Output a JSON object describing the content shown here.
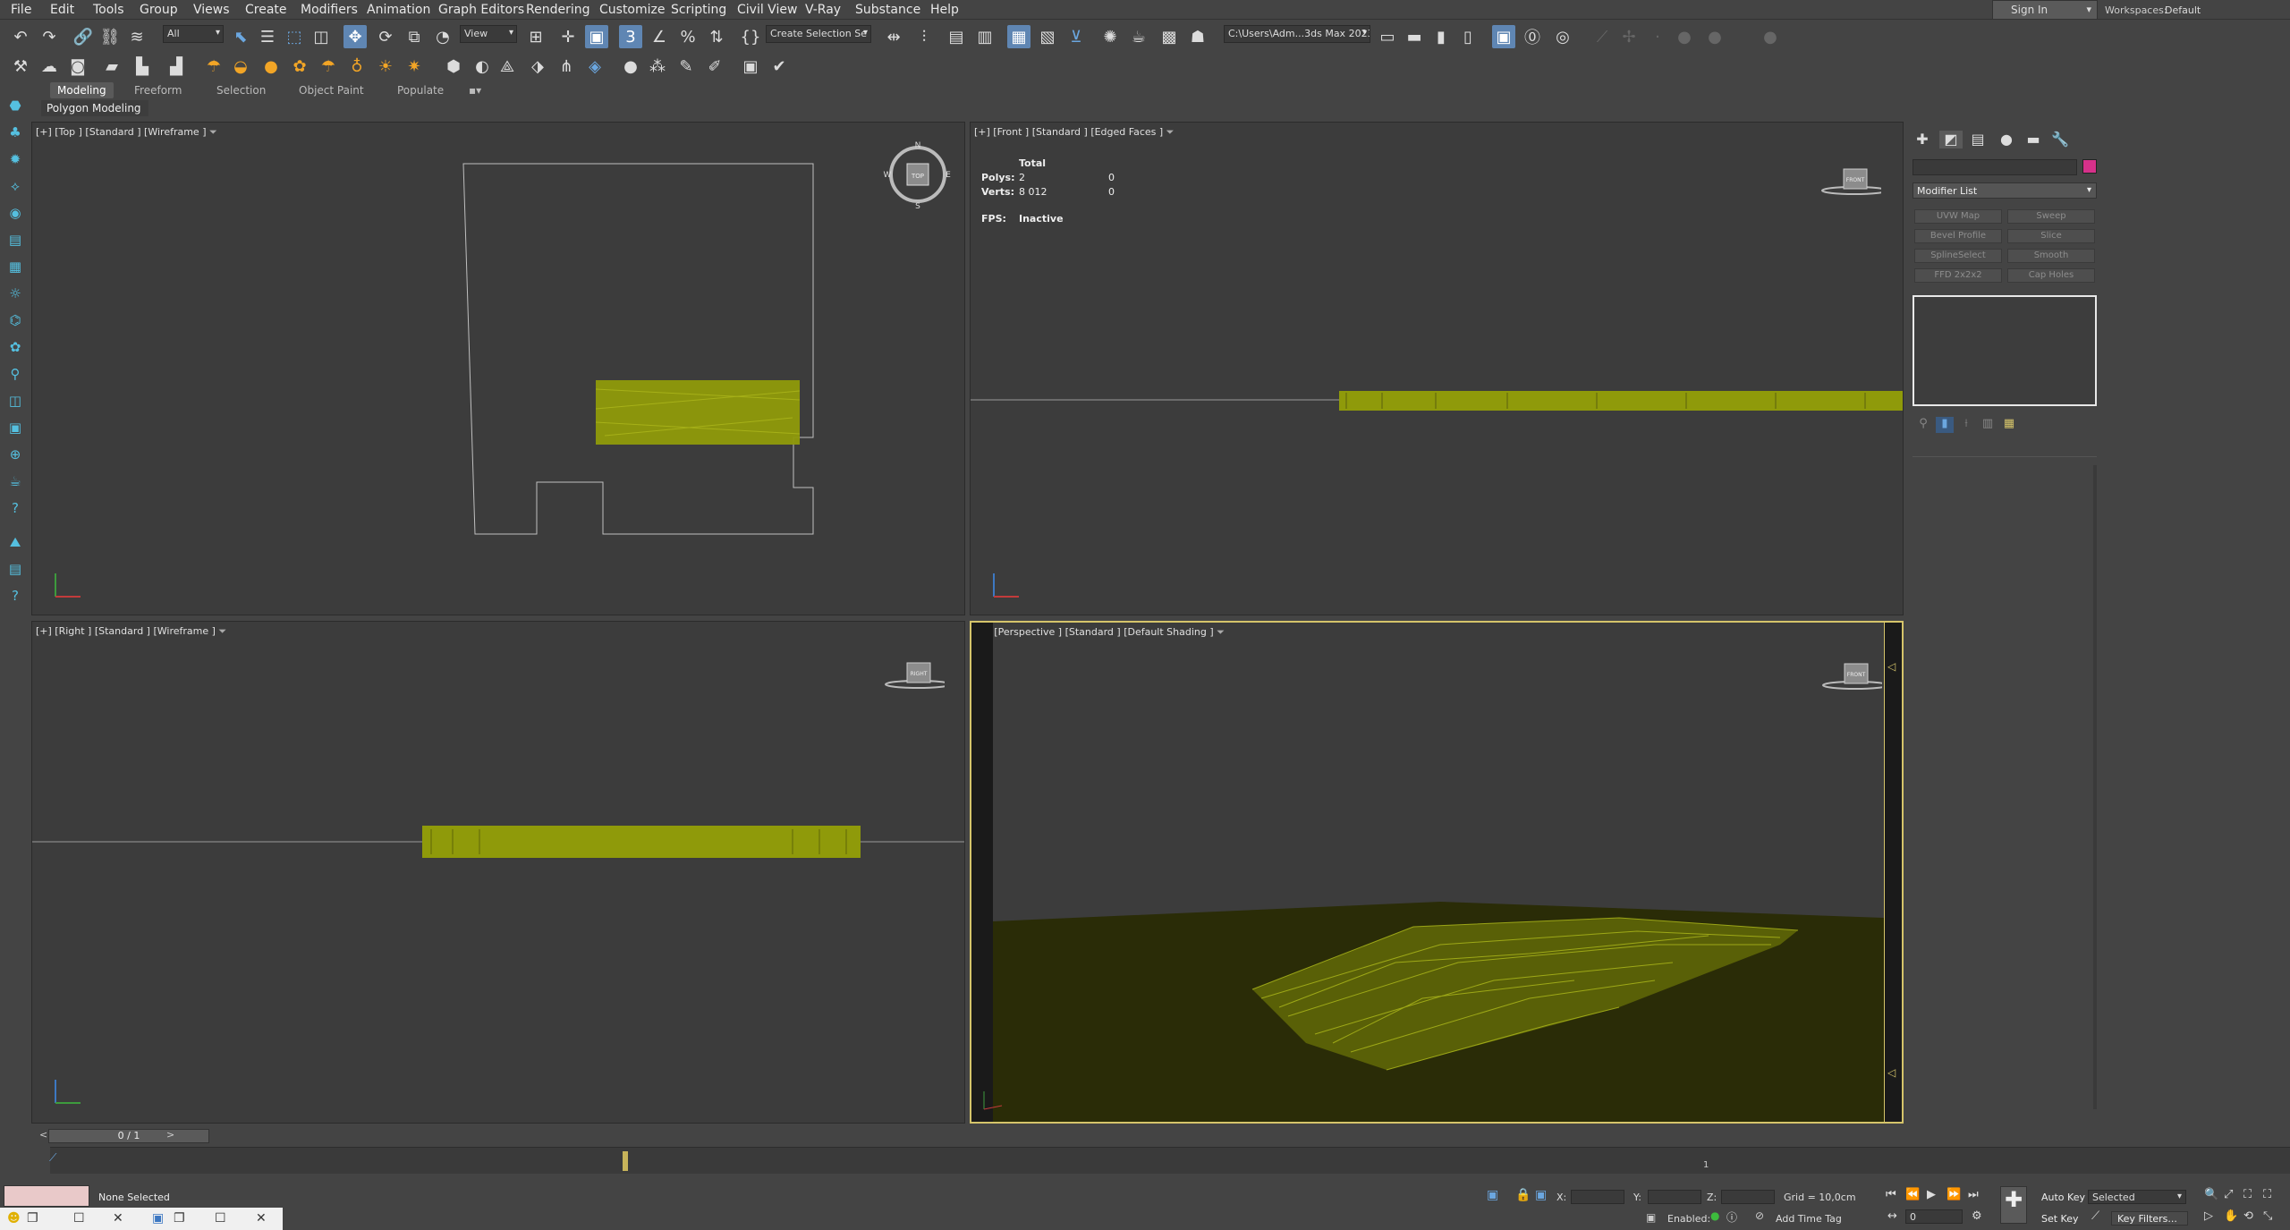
{
  "menu": {
    "items": [
      "File",
      "Edit",
      "Tools",
      "Group",
      "Views",
      "Create",
      "Modifiers",
      "Animation",
      "Graph Editors",
      "Rendering",
      "Customize",
      "Scripting",
      "Civil View",
      "V-Ray",
      "Substance",
      "Help"
    ],
    "sign_in": "Sign In",
    "workspaces_label": "Workspaces:",
    "workspaces_value": "Default"
  },
  "toolbar": {
    "selection_filter": "All",
    "ref_coord": "View",
    "named_selection": "Create Selection Se",
    "project_path": "C:\\Users\\Adm...3ds Max 2023"
  },
  "ribbon": {
    "tabs": [
      "Modeling",
      "Freeform",
      "Selection",
      "Object Paint",
      "Populate"
    ],
    "active_tab": "Modeling",
    "panel_label": "Polygon Modeling"
  },
  "viewports": {
    "top": {
      "label": "[+] [Top ] [Standard ] [Wireframe ]"
    },
    "front": {
      "label": "[+] [Front ] [Standard ] [Edged Faces ]"
    },
    "right": {
      "label": "[+] [Right ] [Standard ] [Wireframe ]"
    },
    "perspective": {
      "label": "[+] [Perspective ] [Standard ] [Default Shading ]"
    },
    "compass": {
      "n": "N",
      "s": "S",
      "e": "E",
      "w": "W",
      "cube_label": "TOP"
    },
    "cube_labels": {
      "front": "FRONT",
      "right": "RIGHT",
      "persp": "FRONT"
    }
  },
  "stats": {
    "header": "Total",
    "polys_label": "Polys:",
    "polys_total": "2",
    "polys_sel": "0",
    "verts_label": "Verts:",
    "verts_total": "8 012",
    "verts_sel": "0",
    "fps_label": "FPS:",
    "fps_value": "Inactive"
  },
  "command_panel": {
    "modifier_list": "Modifier List",
    "object_color": "#d6318a",
    "modifier_buttons": [
      "UVW Map",
      "Sweep",
      "Bevel Profile",
      "Slice",
      "SplineSelect",
      "Smooth",
      "FFD 2x2x2",
      "Cap Holes"
    ]
  },
  "timeline": {
    "frame_display": "0 / 1",
    "end_frame": "1"
  },
  "status": {
    "selection": "None Selected",
    "x_label": "X:",
    "y_label": "Y:",
    "z_label": "Z:",
    "grid": "Grid = 10,0cm",
    "enabled_label": "Enabled:",
    "add_time_tag": "Add Time Tag",
    "auto_key": "Auto Key",
    "set_key": "Set Key",
    "key_mode": "Selected",
    "key_filters": "Key Filters...",
    "current_frame": "0"
  },
  "colors": {
    "grass": "#8f9a0a",
    "viewport_bg": "#3c3c3c",
    "active_border": "#d5c46a",
    "ground": "#2a2c07"
  }
}
